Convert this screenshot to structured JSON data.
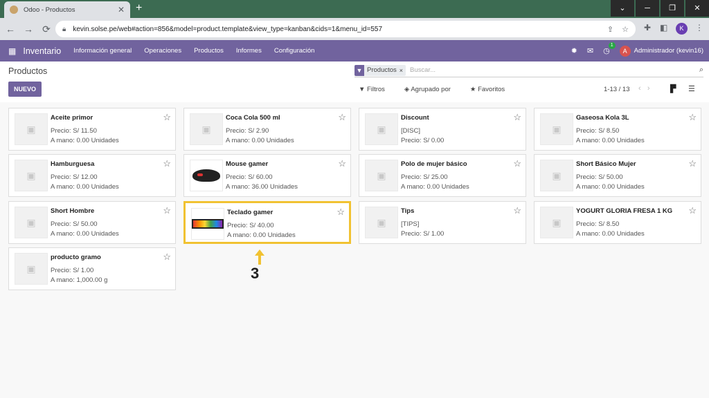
{
  "browser": {
    "tab_title": "Odoo - Productos",
    "tab_close": "✕",
    "new_tab": "+",
    "url": "kevin.solse.pe/web#action=856&model=product.template&view_type=kanban&cids=1&menu_id=557",
    "profile_initial": "K",
    "window_controls": [
      "⌄",
      "─",
      "❐",
      "✕"
    ]
  },
  "navbar": {
    "app_name": "Inventario",
    "menu": [
      "Información general",
      "Operaciones",
      "Productos",
      "Informes",
      "Configuración"
    ],
    "activity_badge": "1",
    "user_initial": "A",
    "user_name": "Administrador (kevin16)"
  },
  "control_panel": {
    "breadcrumb": "Productos",
    "new_button": "NUEVO",
    "facet_label": "Productos",
    "facet_remove": "×",
    "search_placeholder": "Buscar...",
    "filters": "Filtros",
    "group_by": "Agrupado por",
    "favorites": "Favoritos",
    "pager": "1-13 / 13"
  },
  "products": [
    {
      "name": "Aceite primor",
      "line1": "Precio: S/ 11.50",
      "line2": "A mano: 0.00 Unidades"
    },
    {
      "name": "Coca Cola 500 ml",
      "line1": "Precio: S/ 2.90",
      "line2": "A mano: 0.00 Unidades"
    },
    {
      "name": "Discount",
      "line1": "[DISC]",
      "line2": "Precio: S/ 0.00"
    },
    {
      "name": "Gaseosa Kola 3L",
      "line1": "Precio: S/ 8.50",
      "line2": "A mano: 0.00 Unidades"
    },
    {
      "name": "Hamburguesa",
      "line1": "Precio: S/ 12.00",
      "line2": "A mano: 0.00 Unidades"
    },
    {
      "name": "Mouse gamer",
      "line1": "Precio: S/ 60.00",
      "line2": "A mano: 36.00 Unidades"
    },
    {
      "name": "Polo de mujer básico",
      "line1": "Precio: S/ 25.00",
      "line2": "A mano: 0.00 Unidades"
    },
    {
      "name": "Short Básico Mujer",
      "line1": "Precio: S/ 50.00",
      "line2": "A mano: 0.00 Unidades"
    },
    {
      "name": "Short Hombre",
      "line1": "Precio: S/ 50.00",
      "line2": "A mano: 0.00 Unidades"
    },
    {
      "name": "Teclado gamer",
      "line1": "Precio: S/ 40.00",
      "line2": "A mano: 0.00 Unidades"
    },
    {
      "name": "Tips",
      "line1": "[TIPS]",
      "line2": "Precio: S/ 1.00"
    },
    {
      "name": "YOGURT GLORIA FRESA 1 KG",
      "line1": "Precio: S/ 8.50",
      "line2": "A mano: 0.00 Unidades"
    },
    {
      "name": "producto gramo",
      "line1": "Precio: S/ 1.00",
      "line2": "A mano: 1,000.00 g"
    }
  ],
  "callout": {
    "number": "3",
    "color": "#f1c232"
  },
  "colors": {
    "odoo_primary": "#71639e",
    "tab_bar": "#3c6b52",
    "highlight": "#f1c232"
  }
}
